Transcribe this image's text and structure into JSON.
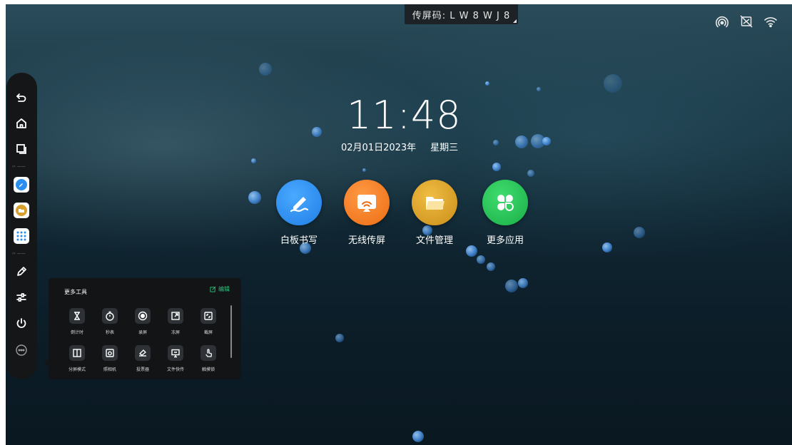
{
  "cast_code": {
    "label": "传屏码: L W 8 W J 8"
  },
  "status_icons": [
    "hotspot-icon",
    "screen-share-off-icon",
    "wifi-icon"
  ],
  "clock": {
    "time": "11:48",
    "date": "02月01日2023年",
    "weekday": "星期三"
  },
  "apps": [
    {
      "label": "白板书写",
      "icon": "whiteboard-pen-icon",
      "color": "#2a8ff0"
    },
    {
      "label": "无线传屏",
      "icon": "wireless-cast-icon",
      "color": "#f07a22"
    },
    {
      "label": "文件管理",
      "icon": "folder-icon",
      "color": "#d7a02c"
    },
    {
      "label": "更多应用",
      "icon": "more-apps-clover-icon",
      "color": "#22c55a"
    }
  ],
  "sidebar": {
    "items": [
      "back-icon",
      "home-icon",
      "multitask-icon",
      "whiteboard-app-icon",
      "file-manager-app-icon",
      "apps-grid-icon",
      "pen-annotate-icon",
      "settings-sliders-icon",
      "power-icon",
      "more-tools-icon"
    ]
  },
  "more_tools": {
    "title": "更多工具",
    "edit_label": "编辑",
    "tools": [
      {
        "label": "倒计时",
        "icon": "hourglass-icon"
      },
      {
        "label": "秒表",
        "icon": "stopwatch-icon"
      },
      {
        "label": "录屏",
        "icon": "record-icon"
      },
      {
        "label": "冻屏",
        "icon": "freeze-screen-icon"
      },
      {
        "label": "截屏",
        "icon": "screenshot-icon"
      },
      {
        "label": "分屏模式",
        "icon": "split-screen-icon"
      },
      {
        "label": "照相机",
        "icon": "camera-icon"
      },
      {
        "label": "投票器",
        "icon": "vote-icon"
      },
      {
        "label": "文件快传",
        "icon": "file-transfer-icon"
      },
      {
        "label": "触摸锁",
        "icon": "touch-lock-icon"
      }
    ]
  },
  "colors": {
    "accent_green": "#2fc27b",
    "sidebar_bg": "#141618",
    "panel_bg": "#121416"
  }
}
